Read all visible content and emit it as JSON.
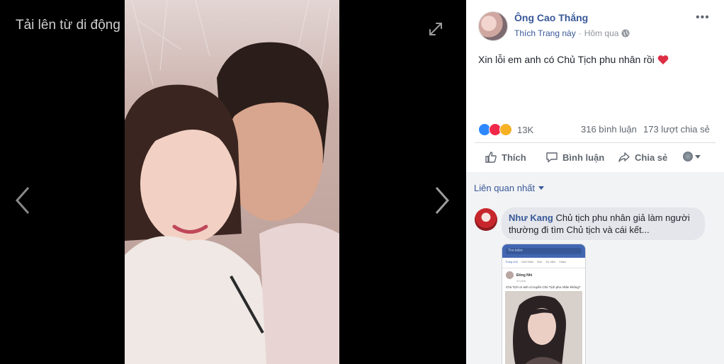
{
  "viewer": {
    "title": "Tải lên từ di động"
  },
  "post": {
    "author": "Ông Cao Thắng",
    "like_page": "Thích Trang này",
    "separator": "·",
    "time": "Hôm qua",
    "text": "Xin lỗi em anh có Chủ Tịch phu nhân rồi",
    "reaction_count": "13K",
    "comment_count": "316 bình luận",
    "share_count": "173 lượt chia sẻ"
  },
  "actions": {
    "like": "Thích",
    "comment": "Bình luận",
    "share": "Chia sẻ"
  },
  "comments": {
    "sort_label": "Liên quan nhất",
    "items": [
      {
        "author": "Như Kang",
        "text": "Chủ tịch phu nhân giả làm người thường đi tìm Chủ tịch và cái kết..."
      }
    ]
  },
  "comment_image": {
    "search_placeholder": "Tìm kiếm",
    "tabs": [
      "Trang chủ",
      "Giới thiệu",
      "Ảnh",
      "Sự kiện",
      "Video"
    ],
    "author": "Đông Nhi",
    "time": "29 phút",
    "text": "Chủ Tịch ơi anh có tuyển Chủ Tịch phu nhân không?"
  },
  "colors": {
    "link_blue": "#385898",
    "text_gray": "#606770",
    "like_blue": "#2d88ff",
    "love_red": "#f0284a",
    "haha_yellow": "#f7b125"
  },
  "icons": [
    "expand-icon",
    "chevron-left-icon",
    "chevron-right-icon",
    "globe-icon",
    "heart-icon",
    "thumbs-up-icon",
    "comment-icon",
    "share-icon"
  ]
}
